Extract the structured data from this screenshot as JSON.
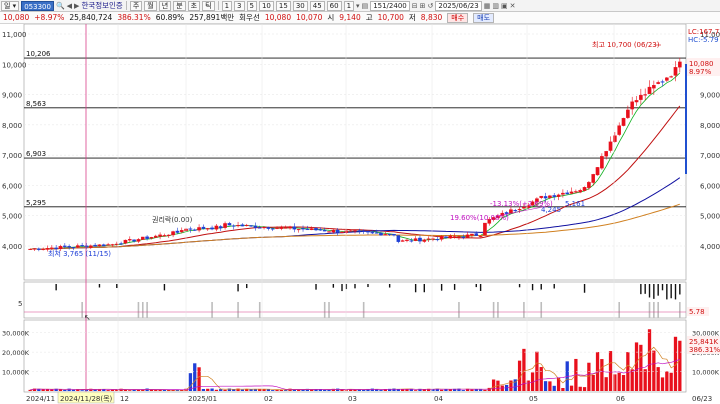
{
  "toolbar": {
    "period_label": "일",
    "code": "053300",
    "stock_name": "한국정보인증",
    "tabs": [
      "주",
      "월",
      "년",
      "분",
      "초",
      "틱"
    ],
    "intervals": [
      "1",
      "3",
      "5",
      "10",
      "15",
      "30",
      "45",
      "60"
    ],
    "bar_count": "151/2400",
    "date": "2025/06/23"
  },
  "info": {
    "last": "10,080",
    "change": "+8.97%",
    "volume": "25,840,724",
    "volume_ratio": "386.31%",
    "turnover": "60.89%",
    "value": "257,891백만",
    "vi_label": "회우선",
    "bid": "10,080",
    "ask": "10,070",
    "open_label": "시",
    "open": "9,140",
    "high_label": "고",
    "high": "10,700",
    "low_label": "저",
    "low": "8,830",
    "sell_label": "매수",
    "buy_label": "매도"
  },
  "price_axis": {
    "labels": [
      "11,000",
      "10,000",
      "9,000",
      "8,000",
      "7,000",
      "6,000",
      "5,000",
      "4,000"
    ],
    "current_price": "10,080",
    "current_change": "8.97%"
  },
  "corner_labels": {
    "lc": "LC:167.73",
    "hc": "HC:-5.79"
  },
  "levels": [
    "10,206",
    "8,563",
    "6,903",
    "5,295"
  ],
  "annotations": {
    "high": "최고 10,700 (06/23)",
    "low": "최저 3,765 (11/15)",
    "ex_div": "권리락(0.00)",
    "pct1": "19.60%(10.08%)",
    "pct2": "-13.13%(+2.69%)",
    "pct3": "4,245",
    "pct4": "5,161"
  },
  "indicator_axis": {
    "label": "5",
    "value": "5.78"
  },
  "volume_axis": {
    "labels": [
      "30,000K",
      "20,000K",
      "10,000K"
    ],
    "current": "25,841K",
    "current_pct": "386.31%"
  },
  "time_axis": {
    "labels": [
      "2024/11",
      "12",
      "2025/01",
      "02",
      "03",
      "04",
      "05",
      "06",
      "06/23"
    ],
    "cursor_date": "2024/11/28(목)"
  },
  "colors": {
    "up": "#e8101c",
    "down": "#1f3fd6",
    "ma5": "#10b020",
    "ma20": "#c01010",
    "ma60": "#1010a0",
    "ma120": "#d08020",
    "cursor": "#d8408a"
  }
}
